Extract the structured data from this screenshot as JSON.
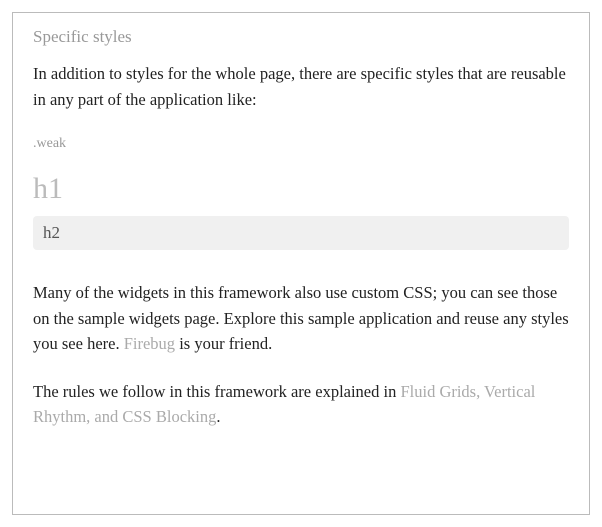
{
  "section_title": "Specific styles",
  "intro": "In addition to styles for the whole page, there are specific styles that are reusable in any part of the application like:",
  "weak_label": ".weak",
  "h1_text": "h1",
  "h2_text": "h2",
  "para1_before": "Many of the widgets in this framework also use custom CSS; you can see those on the sample widgets page. Explore this sample application and reuse any styles you see here. ",
  "para1_link": "Firebug",
  "para1_after": " is your friend.",
  "para2_before": "The rules we follow in this framework are explained in ",
  "para2_link": "Fluid Grids, Vertical Rhythm, and CSS Blocking",
  "para2_after": "."
}
